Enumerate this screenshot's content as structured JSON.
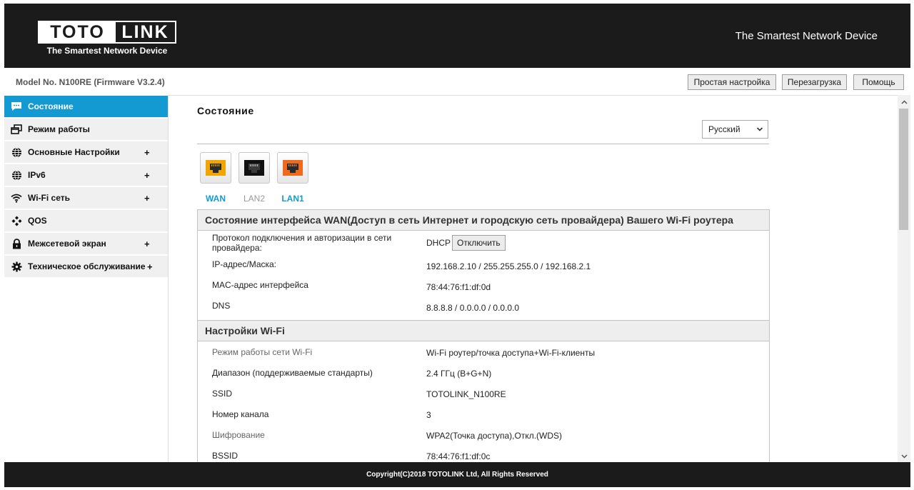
{
  "header": {
    "logo_left": "TOTO",
    "logo_right": "LINK",
    "logo_tagline": "The Smartest Network Device",
    "tagline": "The Smartest Network Device"
  },
  "modelbar": {
    "model_text": "Model No. N100RE (Firmware V3.2.4)",
    "buttons": [
      "Простая настройка",
      "Перезагрузка",
      "Помощь"
    ]
  },
  "sidebar": {
    "items": [
      {
        "label": "Состояние",
        "icon": "chat-icon",
        "active": true,
        "expandable": false
      },
      {
        "label": "Режим работы",
        "icon": "windows-icon",
        "active": false,
        "expandable": false
      },
      {
        "label": "Основные Настройки",
        "icon": "globe-icon",
        "active": false,
        "expandable": true
      },
      {
        "label": "IPv6",
        "icon": "globe-icon",
        "active": false,
        "expandable": true
      },
      {
        "label": "Wi-Fi сеть",
        "icon": "wifi-icon",
        "active": false,
        "expandable": true
      },
      {
        "label": "QOS",
        "icon": "qos-icon",
        "active": false,
        "expandable": false
      },
      {
        "label": "Межсетевой экран",
        "icon": "lock-icon",
        "active": false,
        "expandable": true
      },
      {
        "label": "Техническое обслуживание",
        "icon": "gear-icon",
        "active": false,
        "expandable": true
      }
    ],
    "plus": "+"
  },
  "main": {
    "title": "Состояние",
    "language": "Русский",
    "ports": [
      {
        "label": "WAN",
        "color": "#f0a500",
        "label_color": "#139ad2"
      },
      {
        "label": "LAN2",
        "color": "#111111",
        "label_color": "#999999"
      },
      {
        "label": "LAN1",
        "color": "#f06a1e",
        "label_color": "#139ad2"
      }
    ],
    "wan_section": {
      "title": "Состояние интерфейса WAN(Доступ в сеть Интернет и городскую сеть провайдера) Вашего Wi-Fi роутера",
      "protocol_label": "Протокол подключения и авторизации в сети провайдера:",
      "protocol_value": "DHCP",
      "disconnect_label": "Отключить",
      "rows": [
        {
          "label": "IP-адрес/Маска:",
          "value": "192.168.2.10 / 255.255.255.0 / 192.168.2.1"
        },
        {
          "label": "MAC-адрес интерфейса",
          "value": "78:44:76:f1:df:0d"
        },
        {
          "label": "DNS",
          "value": "8.8.8.8 / 0.0.0.0 / 0.0.0.0"
        }
      ]
    },
    "wifi_section": {
      "title": "Настройки Wi-Fi",
      "rows": [
        {
          "label": "Режим работы сети Wi-Fi",
          "value": "Wi-Fi роутер/точка доступа+Wi-Fi-клиенты",
          "muted": true
        },
        {
          "label": "Диапазон (поддерживаемые стандарты)",
          "value": "2.4 ГГц (B+G+N)",
          "muted": false
        },
        {
          "label": "SSID",
          "value": "TOTOLINK_N100RE",
          "muted": false
        },
        {
          "label": "Номер канала",
          "value": "3",
          "muted": false
        },
        {
          "label": "Шифрование",
          "value": "WPA2(Точка доступа),Откл.(WDS)",
          "muted": true
        },
        {
          "label": "BSSID",
          "value": "78:44:76:f1:df:0c",
          "muted": false
        }
      ]
    }
  },
  "footer": {
    "copyright": "Copyright(C)2018 TOTOLINK Ltd, All Rights Reserved"
  },
  "colors": {
    "header_bg": "#1b1b1b",
    "accent": "#139ad2",
    "sidebar_bg": "#f0f0f0",
    "section_bg": "#eeeeee"
  }
}
